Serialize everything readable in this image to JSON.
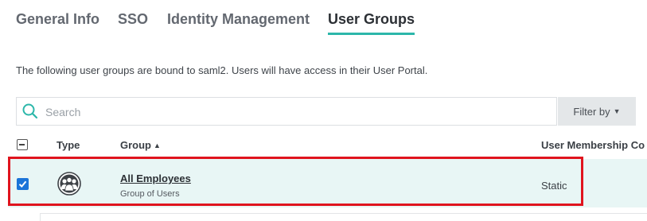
{
  "tabs": [
    {
      "label": "General Info",
      "active": false
    },
    {
      "label": "SSO",
      "active": false
    },
    {
      "label": "Identity Management",
      "active": false
    },
    {
      "label": "User Groups",
      "active": true
    }
  ],
  "description": "The following user groups are bound to saml2. Users will have access in their User Portal.",
  "search": {
    "placeholder": "Search",
    "value": ""
  },
  "filter": {
    "label": "Filter by"
  },
  "table": {
    "headers": {
      "type": "Type",
      "group": "Group",
      "membership": "User Membership Co"
    },
    "sort": {
      "column": "group",
      "direction": "ascending"
    },
    "rows": [
      {
        "selected": true,
        "type_icon": "user-group-icon",
        "group": "All Employees",
        "subtitle": "Group of Users",
        "membership": "Static"
      }
    ]
  },
  "colors": {
    "accent": "#2cb7aa",
    "highlight_border": "#e0141e",
    "checkbox": "#1b74d8",
    "row_bg": "#e8f6f5"
  }
}
